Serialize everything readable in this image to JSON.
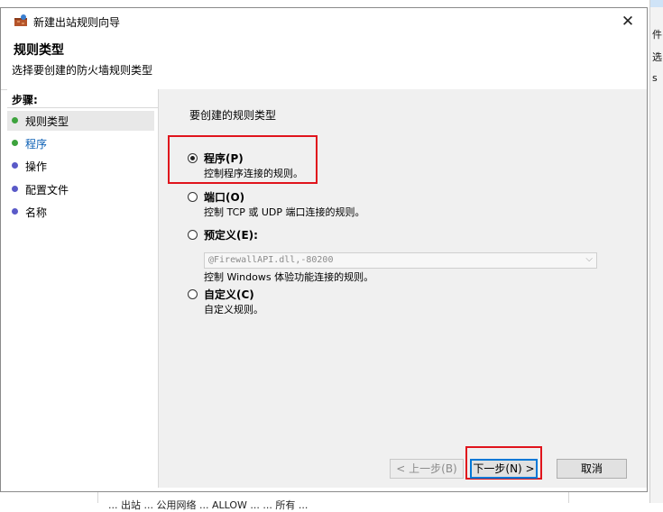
{
  "window": {
    "title": "新建出站规则向导",
    "close_icon": "close-icon"
  },
  "header": {
    "heading": "规则类型",
    "subtitle": "选择要创建的防火墙规则类型"
  },
  "steps": {
    "title": "步骤:",
    "items": [
      {
        "label": "规则类型",
        "dot_color": "#3da33d",
        "active": true
      },
      {
        "label": "程序",
        "dot_color": "#3da33d",
        "active": false
      },
      {
        "label": "操作",
        "dot_color": "#5a5ac8",
        "active": false
      },
      {
        "label": "配置文件",
        "dot_color": "#5a5ac8",
        "active": false
      },
      {
        "label": "名称",
        "dot_color": "#5a5ac8",
        "active": false
      }
    ]
  },
  "content": {
    "prompt": "要创建的规则类型",
    "options": [
      {
        "label": "程序(P)",
        "desc": "控制程序连接的规则。",
        "selected": true
      },
      {
        "label": "端口(O)",
        "desc": "控制 TCP 或 UDP 端口连接的规则。",
        "selected": false
      },
      {
        "label": "预定义(E):",
        "desc": "控制 Windows 体验功能连接的规则。",
        "selected": false
      },
      {
        "label": "自定义(C)",
        "desc": "自定义规则。",
        "selected": false
      }
    ],
    "predefined_value": "@FirewallAPI.dll,-80200"
  },
  "buttons": {
    "back": "< 上一步(B)",
    "next": "下一步(N) >",
    "cancel": "取消"
  },
  "colors": {
    "highlight": "#e0141c",
    "active_step_bg": "#e8e8e8",
    "content_bg": "#f0f0f0"
  },
  "background_app": {
    "right_texts": [
      "件(",
      "选",
      "s"
    ],
    "bottom_text": "... 出站 ... 公用网络 ... ALLOW ... ... 所有 ..."
  }
}
